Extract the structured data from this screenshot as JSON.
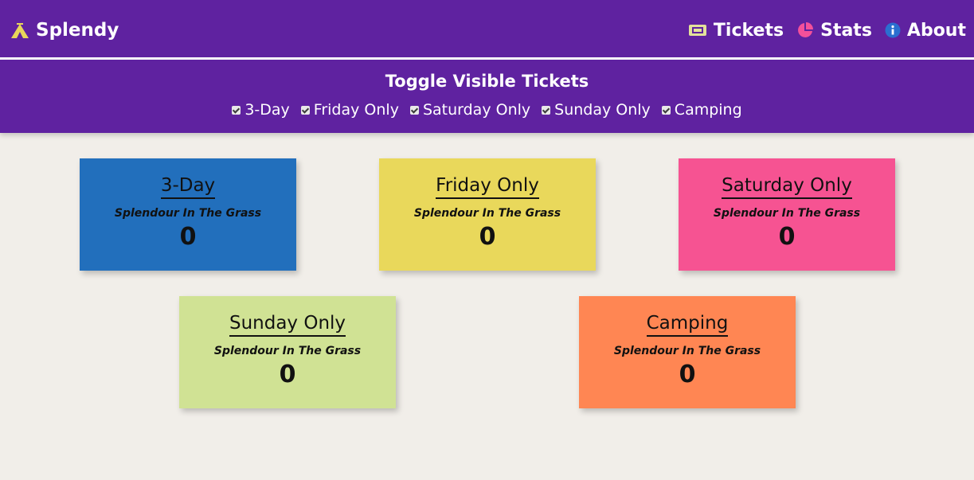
{
  "brand": {
    "name": "Splendy",
    "icon": "tent-icon",
    "icon_color": "#e9d65a"
  },
  "nav": {
    "links": [
      {
        "label": "Tickets",
        "icon": "ticket-icon",
        "color": "#e3e19a"
      },
      {
        "label": "Stats",
        "icon": "pie-chart-icon",
        "color": "#f4509a"
      },
      {
        "label": "About",
        "icon": "info-icon",
        "color": "#2a6fd0"
      }
    ]
  },
  "toggles": {
    "title": "Toggle Visible Tickets",
    "items": [
      {
        "label": "3-Day",
        "checked": true
      },
      {
        "label": "Friday Only",
        "checked": true
      },
      {
        "label": "Saturday Only",
        "checked": true
      },
      {
        "label": "Sunday Only",
        "checked": true
      },
      {
        "label": "Camping",
        "checked": true
      }
    ]
  },
  "cards": [
    {
      "title": "3-Day",
      "event": "Splendour In The Grass",
      "count": "0",
      "color": "#226fbc"
    },
    {
      "title": "Friday Only",
      "event": "Splendour In The Grass",
      "count": "0",
      "color": "#e9d85b"
    },
    {
      "title": "Saturday Only",
      "event": "Splendour In The Grass",
      "count": "0",
      "color": "#f65392"
    },
    {
      "title": "Sunday Only",
      "event": "Splendour In The Grass",
      "count": "0",
      "color": "#d0e294"
    },
    {
      "title": "Camping",
      "event": "Splendour In The Grass",
      "count": "0",
      "color": "#ff8653"
    }
  ]
}
